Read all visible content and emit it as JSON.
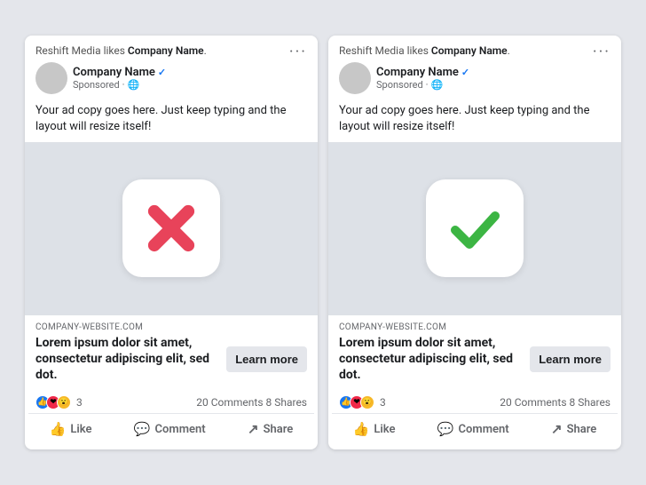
{
  "cards": [
    {
      "id": "card-left",
      "headerText": "Reshift Media likes ",
      "headerBold": "Company Name",
      "headerDot": ".",
      "companyName": "Company Name",
      "sponsored": "Sponsored",
      "adBodyText": "Your ad copy goes here. Just keep typing and the layout will resize itself!",
      "iconType": "cross",
      "websiteUrl": "COMPANY-WEBSITE.COM",
      "loremText": "Lorem ipsum dolor sit amet, consectetur adipiscing elit, sed dot.",
      "learnMoreLabel": "Learn more",
      "reactionsCount": "3",
      "commentsShares": "20 Comments  8 Shares",
      "likeLabel": "Like",
      "commentLabel": "Comment",
      "shareLabel": "Share"
    },
    {
      "id": "card-right",
      "headerText": "Reshift Media likes ",
      "headerBold": "Company Name",
      "headerDot": ".",
      "companyName": "Company Name",
      "sponsored": "Sponsored",
      "adBodyText": "Your ad copy goes here. Just keep typing and the layout will resize itself!",
      "iconType": "check",
      "websiteUrl": "COMPANY-WEBSITE.COM",
      "loremText": "Lorem ipsum dolor sit amet, consectetur adipiscing elit, sed dot.",
      "learnMoreLabel": "Learn more",
      "reactionsCount": "3",
      "commentsShares": "20 Comments  8 Shares",
      "likeLabel": "Like",
      "commentLabel": "Comment",
      "shareLabel": "Share"
    }
  ],
  "icons": {
    "more": "···",
    "verified": "✓",
    "globe": "🌐",
    "like": "👍",
    "comment": "💬",
    "share": "↗"
  }
}
